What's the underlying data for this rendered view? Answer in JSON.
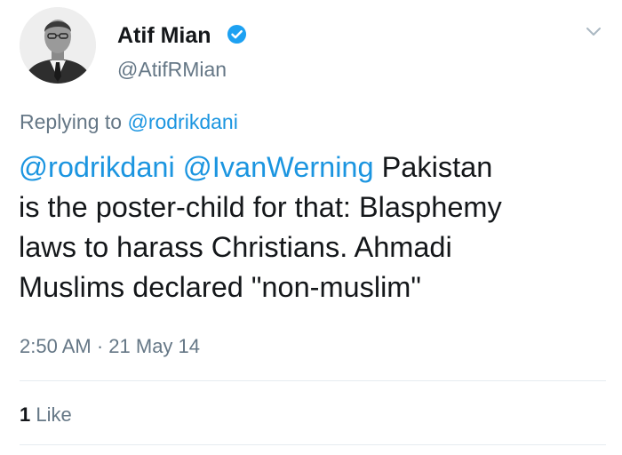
{
  "tweet": {
    "author": {
      "display_name": "Atif Mian",
      "handle": "@AtifRMian",
      "verified": true,
      "avatar_icon": "avatar-photo-icon"
    },
    "reply_context": {
      "prefix": "Replying to ",
      "mention": "@rodrikdani"
    },
    "text": {
      "mention_1": "@rodrikdani",
      "mention_2": "@IvanWerning",
      "line1_rest": " Pakistan",
      "line2": "is the poster-child for that: Blasphemy",
      "line3": "laws to harass Christians. Ahmadi",
      "line4": "Muslims declared \"non-muslim\""
    },
    "timestamp": {
      "time": "2:50 AM",
      "separator": " · ",
      "date": "21 May 14"
    },
    "engagement": {
      "like_count": "1",
      "like_label": " Like"
    },
    "colors": {
      "link": "#1b95e0",
      "secondary_text": "#657786",
      "primary_text": "#14171a",
      "verified_badge": "#1da1f2"
    },
    "icons": {
      "verified": "verified-badge-icon",
      "menu": "chevron-down-icon"
    }
  }
}
